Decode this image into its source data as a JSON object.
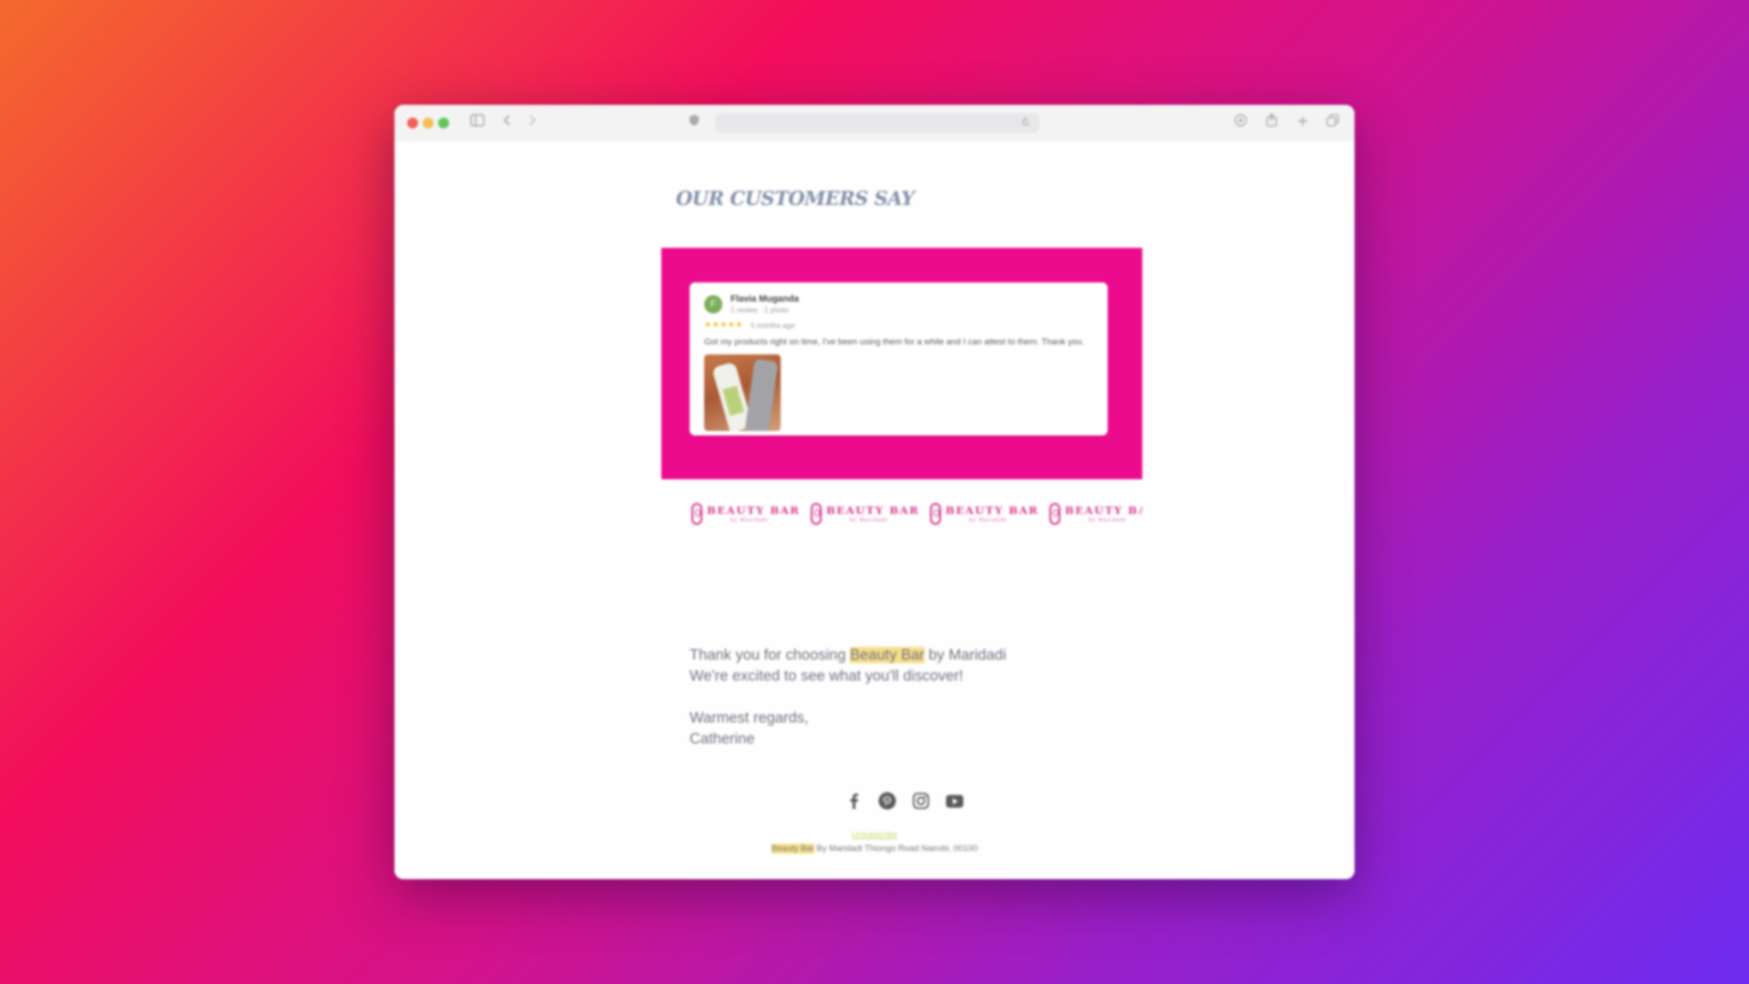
{
  "browser": {
    "traffic_lights": [
      "#f26157",
      "#f6be50",
      "#5fc85a"
    ],
    "icons": {
      "sidebar": "sidebar-icon",
      "back": "chevron-left-icon",
      "forward": "chevron-right-icon",
      "privacy": "shield-icon",
      "reload": "reload-icon",
      "downloads": "download-icon",
      "share": "share-icon",
      "new_tab": "plus-icon",
      "tabs": "tabs-overview-icon"
    }
  },
  "email": {
    "section_title": "OUR CUSTOMERS SAY",
    "review": {
      "avatar_letter": "F",
      "name": "Flavia Muganda",
      "meta": "1 review · 1 photo",
      "stars": "★★★★★",
      "date": "5 months ago",
      "text": "Got my products right on time, I've been using them for a while and I can attest to them. Thank you."
    },
    "logos": [
      {
        "main": "BEAUTY BAR",
        "sub": "by Maridadi"
      },
      {
        "main": "BEAUTY BAR",
        "sub": "by Maridadi"
      },
      {
        "main": "BEAUTY BAR",
        "sub": "by Maridadi"
      },
      {
        "main": "BEAUTY BAR",
        "sub": "by Maridadi"
      }
    ],
    "message": {
      "line1_pre": "Thank you for choosing ",
      "line1_highlight": "Beauty Bar",
      "line1_post": " by Maridadi",
      "line2": "We're excited to see what you'll discover!",
      "line3": "Warmest regards,",
      "line4": "Catherine"
    },
    "social_icons": [
      "facebook-icon",
      "pinterest-icon",
      "instagram-icon",
      "youtube-icon"
    ],
    "footer": {
      "unsubscribe": "Unsubscribe",
      "address_highlight": "Beauty Bar",
      "address_rest": " By Maridadi Thiongo Road Nairobi, 00100"
    },
    "colors": {
      "accent_pink": "#ec0b8d",
      "logo_pink": "#d8358f",
      "highlight": "#f7df8a",
      "star": "#f3b81c"
    }
  }
}
